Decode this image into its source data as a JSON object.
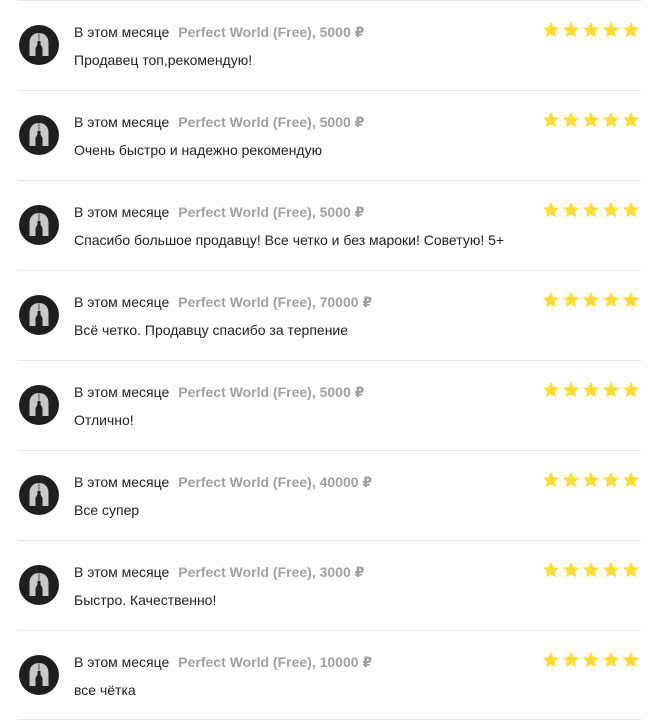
{
  "colors": {
    "star": "#fedc36",
    "avatar_bg": "#1f1f1f",
    "avatar_icon": "#c8c8c8",
    "product_text": "#a0a0a0",
    "divider": "#e6e6e6"
  },
  "reviews": [
    {
      "date": "В этом месяце",
      "product": "Perfect World (Free), 5000 ₽",
      "text": "Продавец топ,рекомендую!",
      "rating": 5,
      "avatar_icon": "spartan-helmet-icon"
    },
    {
      "date": "В этом месяце",
      "product": "Perfect World (Free), 5000 ₽",
      "text": "Очень быстро и надежно рекомендую",
      "rating": 5,
      "avatar_icon": "spartan-helmet-icon"
    },
    {
      "date": "В этом месяце",
      "product": "Perfect World (Free), 5000 ₽",
      "text": "Спасибо большое продавцу! Все четко и без мароки! Советую! 5+",
      "rating": 5,
      "avatar_icon": "spartan-helmet-icon"
    },
    {
      "date": "В этом месяце",
      "product": "Perfect World (Free), 70000 ₽",
      "text": "Всё четко. Продавцу спасибо за терпение",
      "rating": 5,
      "avatar_icon": "spartan-helmet-icon"
    },
    {
      "date": "В этом месяце",
      "product": "Perfect World (Free), 5000 ₽",
      "text": "Отлично!",
      "rating": 5,
      "avatar_icon": "spartan-helmet-icon"
    },
    {
      "date": "В этом месяце",
      "product": "Perfect World (Free), 40000 ₽",
      "text": "Все супер",
      "rating": 5,
      "avatar_icon": "spartan-helmet-icon"
    },
    {
      "date": "В этом месяце",
      "product": "Perfect World (Free), 3000 ₽",
      "text": "Быстро. Качественно!",
      "rating": 5,
      "avatar_icon": "spartan-helmet-icon"
    },
    {
      "date": "В этом месяце",
      "product": "Perfect World (Free), 10000 ₽",
      "text": "все чётка",
      "rating": 5,
      "avatar_icon": "spartan-helmet-icon"
    }
  ]
}
